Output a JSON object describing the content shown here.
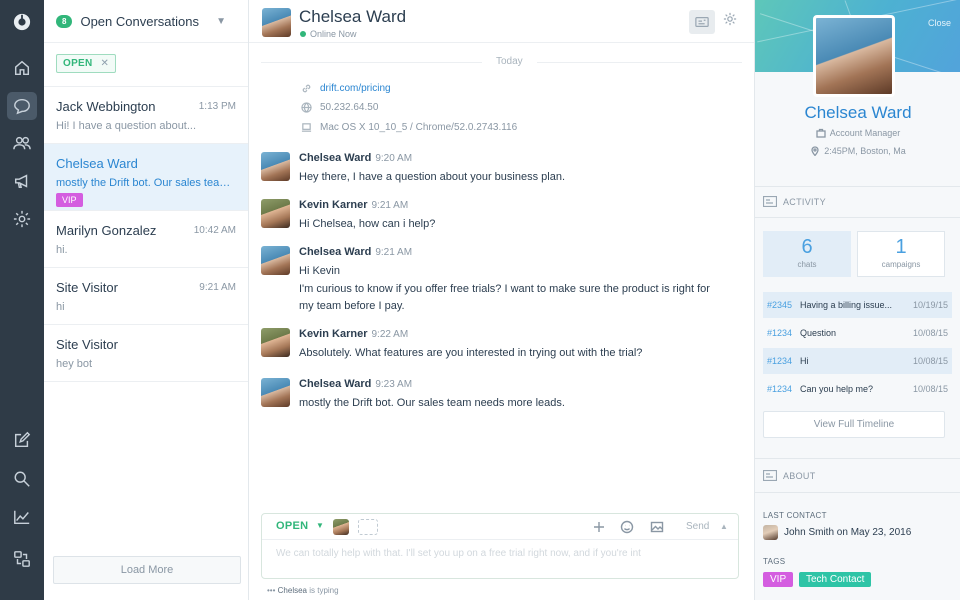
{
  "conversation_list": {
    "open_count": "8",
    "title": "Open Conversations",
    "filter_label": "OPEN",
    "items": [
      {
        "name": "Jack Webbington",
        "time": "1:13 PM",
        "preview": "Hi! I have a question about..."
      },
      {
        "name": "Chelsea Ward",
        "time": "",
        "preview": "mostly the Drift bot. Our sales team...",
        "tag": "VIP"
      },
      {
        "name": "Marilyn Gonzalez",
        "time": "10:42 AM",
        "preview": "hi."
      },
      {
        "name": "Site Visitor",
        "time": "9:21 AM",
        "preview": "hi"
      },
      {
        "name": "Site Visitor",
        "time": "",
        "preview": "hey bot"
      }
    ],
    "load_more": "Load More"
  },
  "chat": {
    "contact_name": "Chelsea Ward",
    "status": "Online Now",
    "day_label": "Today",
    "visitor_meta": {
      "url": "drift.com/pricing",
      "ip": "50.232.64.50",
      "browser": "Mac OS X 10_10_5 / Chrome/52.0.2743.116"
    },
    "messages": [
      {
        "author": "Chelsea Ward",
        "time": "9:20 AM",
        "text": "Hey there, I have a question about your business plan."
      },
      {
        "author": "Kevin Karner",
        "time": "9:21 AM",
        "text": "Hi Chelsea, how can i help?"
      },
      {
        "author": "Chelsea Ward",
        "time": "9:21 AM",
        "text_lines": [
          "Hi Kevin",
          "I'm curious to know if you offer free trials? I want to make sure the product is right for",
          "my team before I pay."
        ]
      },
      {
        "author": "Kevin Karner",
        "time": "9:22 AM",
        "text": "Absolutely. What features are you interested in trying out with the trial?"
      },
      {
        "author": "Chelsea Ward",
        "time": "9:23 AM",
        "text": "mostly the Drift bot. Our sales team needs more leads."
      }
    ],
    "composer": {
      "status": "OPEN",
      "send_label": "Send",
      "draft": "We can totally help with that. I'll set you up on a free trial right now, and if you're int"
    },
    "typing": {
      "name": "Chelsea",
      "text": " is typing"
    }
  },
  "profile": {
    "close_label": "Close",
    "name": "Chelsea Ward",
    "role": "Account Manager",
    "local_time_location": "2:45PM, Boston, Ma",
    "activity_heading": "ACTIVITY",
    "stats": [
      {
        "value": "6",
        "label": "chats"
      },
      {
        "value": "1",
        "label": "campaigns"
      }
    ],
    "timeline": [
      {
        "id": "#2345",
        "subject": "Having a billing issue...",
        "date": "10/19/15"
      },
      {
        "id": "#1234",
        "subject": "Question",
        "date": "10/08/15"
      },
      {
        "id": "#1234",
        "subject": "Hi",
        "date": "10/08/15"
      },
      {
        "id": "#1234",
        "subject": "Can you help me?",
        "date": "10/08/15"
      }
    ],
    "view_full_timeline": "View Full Timeline",
    "about_heading": "ABOUT",
    "last_contact_label": "LAST CONTACT",
    "last_contact": "John Smith on May 23, 2016",
    "tags_label": "TAGS",
    "tags": [
      "VIP",
      "Tech Contact"
    ]
  },
  "colors": {
    "accent_green": "#31b67a",
    "accent_blue": "#2b86d1",
    "vip_purple": "#d45de0",
    "tag_teal": "#2ec4a6",
    "rail": "#2f3b47"
  }
}
